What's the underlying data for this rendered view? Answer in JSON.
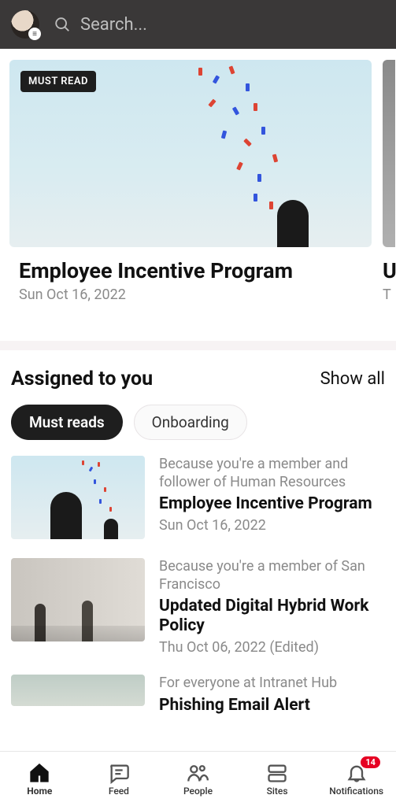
{
  "topbar": {
    "search_placeholder": "Search...",
    "avatar_badge_glyph": "≡"
  },
  "hero": {
    "badge": "MUST READ",
    "title": "Employee Incentive Program",
    "date": "Sun Oct 16, 2022",
    "peek_title_fragment": "U",
    "peek_date_fragment": "T"
  },
  "assigned": {
    "header": "Assigned to you",
    "show_all": "Show all",
    "chips": [
      {
        "label": "Must reads",
        "active": true
      },
      {
        "label": "Onboarding",
        "active": false
      }
    ],
    "items": [
      {
        "reason": "Because you're a member and follower of Human Resources",
        "title": "Employee Incentive Program",
        "date": "Sun Oct 16, 2022"
      },
      {
        "reason": "Because you're a member of San Francisco",
        "title": "Updated Digital Hybrid Work Policy",
        "date": "Thu Oct 06, 2022 (Edited)"
      },
      {
        "reason": "For everyone at Intranet Hub",
        "title": "Phishing Email Alert",
        "date": ""
      }
    ]
  },
  "nav": {
    "home": "Home",
    "feed": "Feed",
    "people": "People",
    "sites": "Sites",
    "notifications": "Notifications",
    "notif_count": "14"
  }
}
